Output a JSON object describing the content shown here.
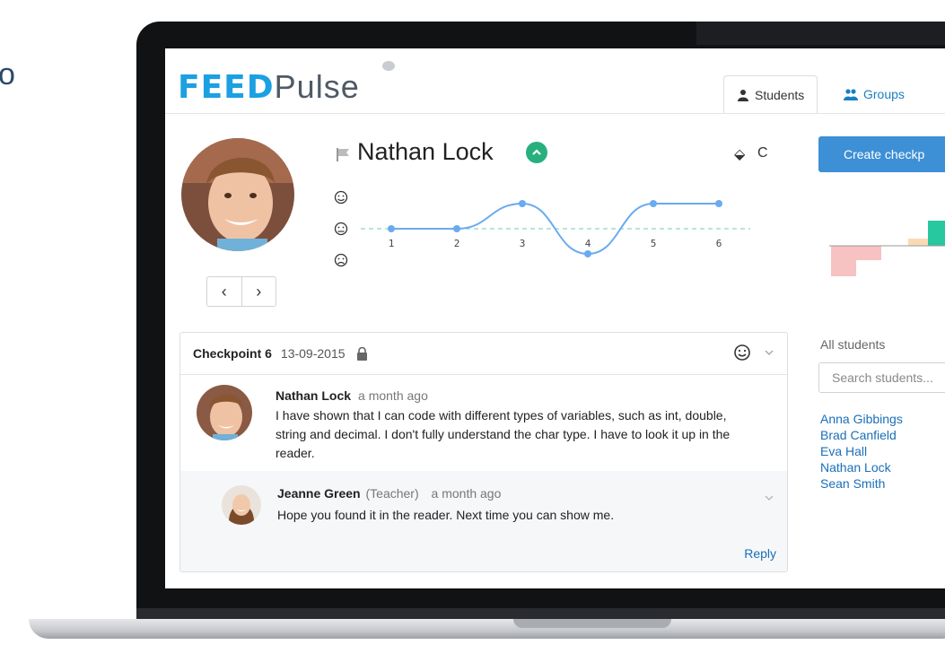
{
  "app": {
    "logo_feed": "FEED",
    "logo_pulse": "Pulse",
    "partial_left_glyph": "o"
  },
  "tabs": [
    {
      "label": "Students",
      "icon": "user-icon",
      "active": true
    },
    {
      "label": "Groups",
      "icon": "group-icon",
      "active": false
    }
  ],
  "student": {
    "name": "Nathan Lock",
    "status_icon": "chevron-up-icon",
    "status_color": "#27b07e"
  },
  "pager": {
    "prev": "‹",
    "next": "›"
  },
  "toolbar": {
    "export_icon": "⬙",
    "refresh_icon": "C"
  },
  "mood_chart": {
    "type": "line",
    "x": [
      1,
      2,
      3,
      4,
      5,
      6
    ],
    "values": [
      0,
      0,
      1,
      -1,
      1,
      1
    ],
    "y_levels": [
      "happy",
      "neutral",
      "sad"
    ],
    "line_color": "#6aaaf0",
    "baseline_color": "#8fd3c9"
  },
  "sidebar": {
    "create_label": "Create checkp",
    "mini_chart_colors": [
      "#f6c2c2",
      "#f6c2c2",
      "#fbd9b5",
      "#27c7a0"
    ],
    "all_students_label": "All students",
    "search_placeholder": "Search students...",
    "students": [
      "Anna Gibbings",
      "Brad Canfield",
      "Eva Hall",
      "Nathan Lock",
      "Sean Smith"
    ]
  },
  "checkpoint": {
    "title": "Checkpoint 6",
    "date": "13-09-2015",
    "comment": {
      "author": "Nathan Lock",
      "time": "a month ago",
      "text": "I have shown that I can code with different types of variables, such as int, double, string and decimal. I don't fully understand the char type. I have to look it up in the reader."
    },
    "reply": {
      "author": "Jeanne Green",
      "role": "(Teacher)",
      "time": "a month ago",
      "text": "Hope you found it in the reader. Next time you can show me.",
      "reply_label": "Reply"
    }
  }
}
